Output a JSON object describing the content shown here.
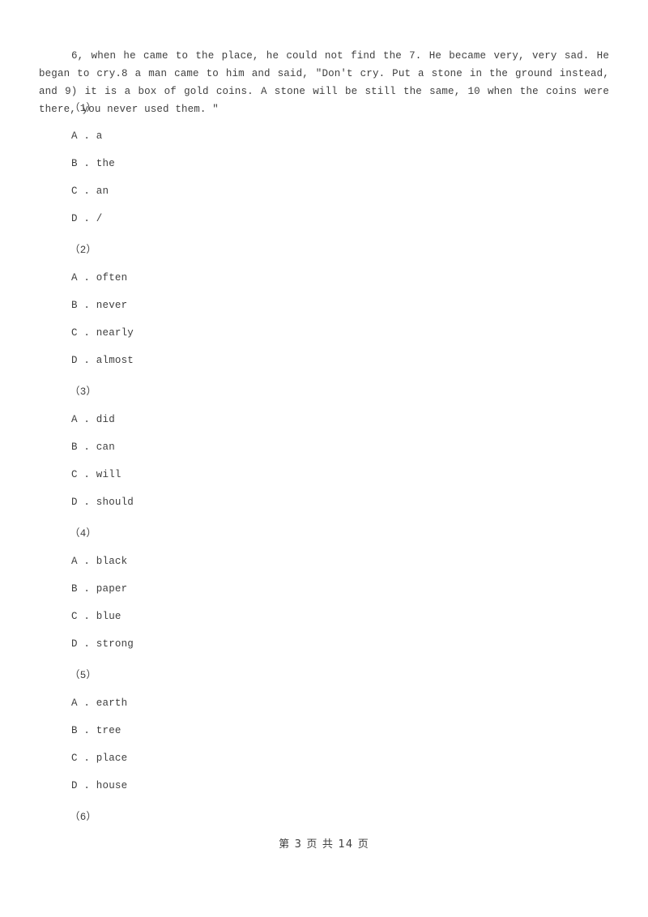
{
  "document": {
    "passage": "6, when he came to the place, he could not find the 7. He became very, very sad. He began to cry.8 a man came to him and said, \"Don't cry. Put a stone in the ground instead, and 9) it is a box of gold coins. A stone will be still the same, 10 when the coins were there, you never used them. \""
  },
  "questions": [
    {
      "number": "（1）",
      "options": [
        "A . a",
        "B . the",
        "C . an",
        "D . /"
      ]
    },
    {
      "number": "（2）",
      "options": [
        "A . often",
        "B . never",
        "C . nearly",
        "D . almost"
      ]
    },
    {
      "number": "（3）",
      "options": [
        "A . did",
        "B . can",
        "C . will",
        "D . should"
      ]
    },
    {
      "number": "（4）",
      "options": [
        "A . black",
        "B . paper",
        "C . blue",
        "D . strong"
      ]
    },
    {
      "number": "（5）",
      "options": [
        "A . earth",
        "B . tree",
        "C . place",
        "D . house"
      ]
    },
    {
      "number": "（6）",
      "options": []
    }
  ],
  "footer": {
    "text": "第 3 页 共 14 页"
  }
}
